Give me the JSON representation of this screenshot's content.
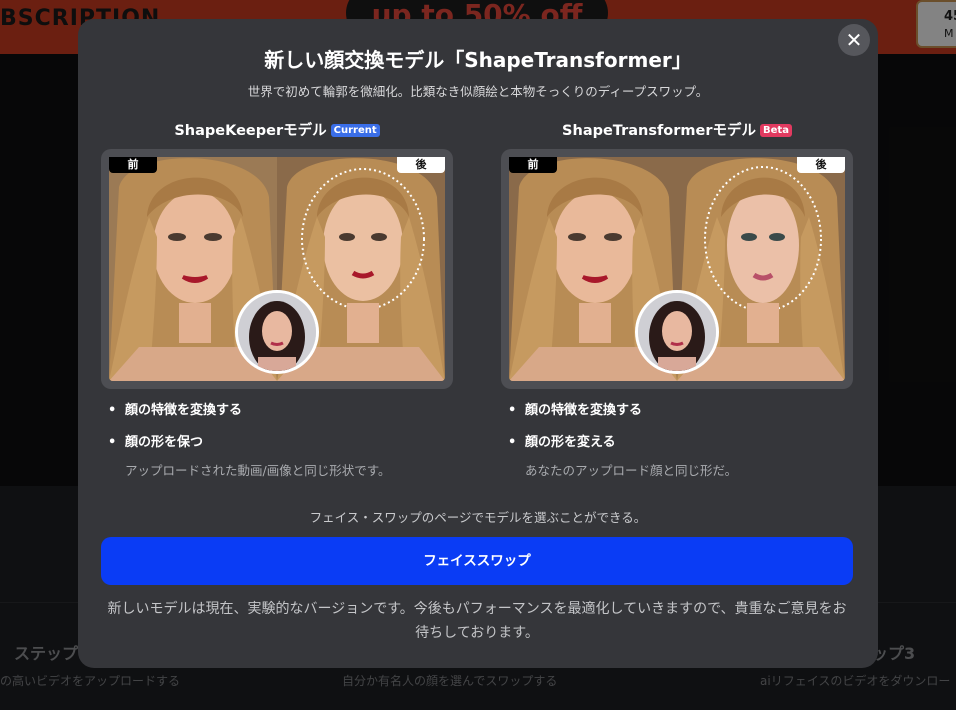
{
  "background": {
    "banner_left_text": "BSCRIPTION",
    "banner_promo": "up to 50% off",
    "timer_value": "45",
    "timer_unit": "M",
    "steps": [
      {
        "title": "ステップ",
        "desc": "の高いビデオをアップロードする"
      },
      {
        "title": "",
        "desc": "自分か有名人の顔を選んでスワップする"
      },
      {
        "title": "ップ3",
        "desc": "aiリフェイスのビデオをダウンロー"
      }
    ]
  },
  "modal": {
    "close_label": "✕",
    "title": "新しい顔交換モデル「ShapeTransformer」",
    "subtitle": "世界で初めて輪郭を微細化。比類なき似顔絵と本物そっくりのディープスワップ。",
    "models": [
      {
        "name": "ShapeKeeperモデル",
        "badge": "Current",
        "before_label": "前",
        "after_label": "後",
        "features": [
          "顔の特徴を変換する",
          "顔の形を保つ"
        ],
        "note": "アップロードされた動画/画像と同じ形状です。"
      },
      {
        "name": "ShapeTransformerモデル",
        "badge": "Beta",
        "before_label": "前",
        "after_label": "後",
        "features": [
          "顔の特徴を変換する",
          "顔の形を変える"
        ],
        "note": "あなたのアップロード顔と同じ形だ。"
      }
    ],
    "footer_note": "フェイス・スワップのページでモデルを選ぶことができる。",
    "primary_button": "フェイススワップ",
    "disclaimer": "新しいモデルは現在、実験的なバージョンです。今後もパフォーマンスを最適化していきますので、貴重なご意見をお待ちしております。"
  },
  "colors": {
    "modal_bg": "#35363a",
    "primary": "#0a3cf5",
    "badge_current": "#3a6ee8",
    "badge_beta": "#e23a60",
    "banner": "#c33a1f"
  }
}
